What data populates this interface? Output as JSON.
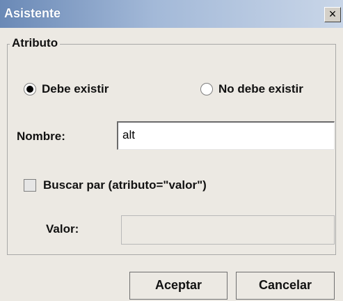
{
  "window": {
    "title": "Asistente",
    "close_glyph": "×"
  },
  "group": {
    "label": "Atributo"
  },
  "radios": [
    {
      "label": "Debe existir",
      "selected": true
    },
    {
      "label": "No debe existir",
      "selected": false
    }
  ],
  "nombre": {
    "label": "Nombre:",
    "value": "alt"
  },
  "buscar_par": {
    "label": "Buscar par (atributo=\"valor\")",
    "checked": false
  },
  "valor": {
    "label": "Valor:",
    "value": "",
    "enabled": false
  },
  "buttons": {
    "accept": "Aceptar",
    "cancel": "Cancelar"
  },
  "colors": {
    "titlebar_start": "#6a89b6",
    "titlebar_end": "#c9d6e8",
    "background": "#ece9e3"
  }
}
